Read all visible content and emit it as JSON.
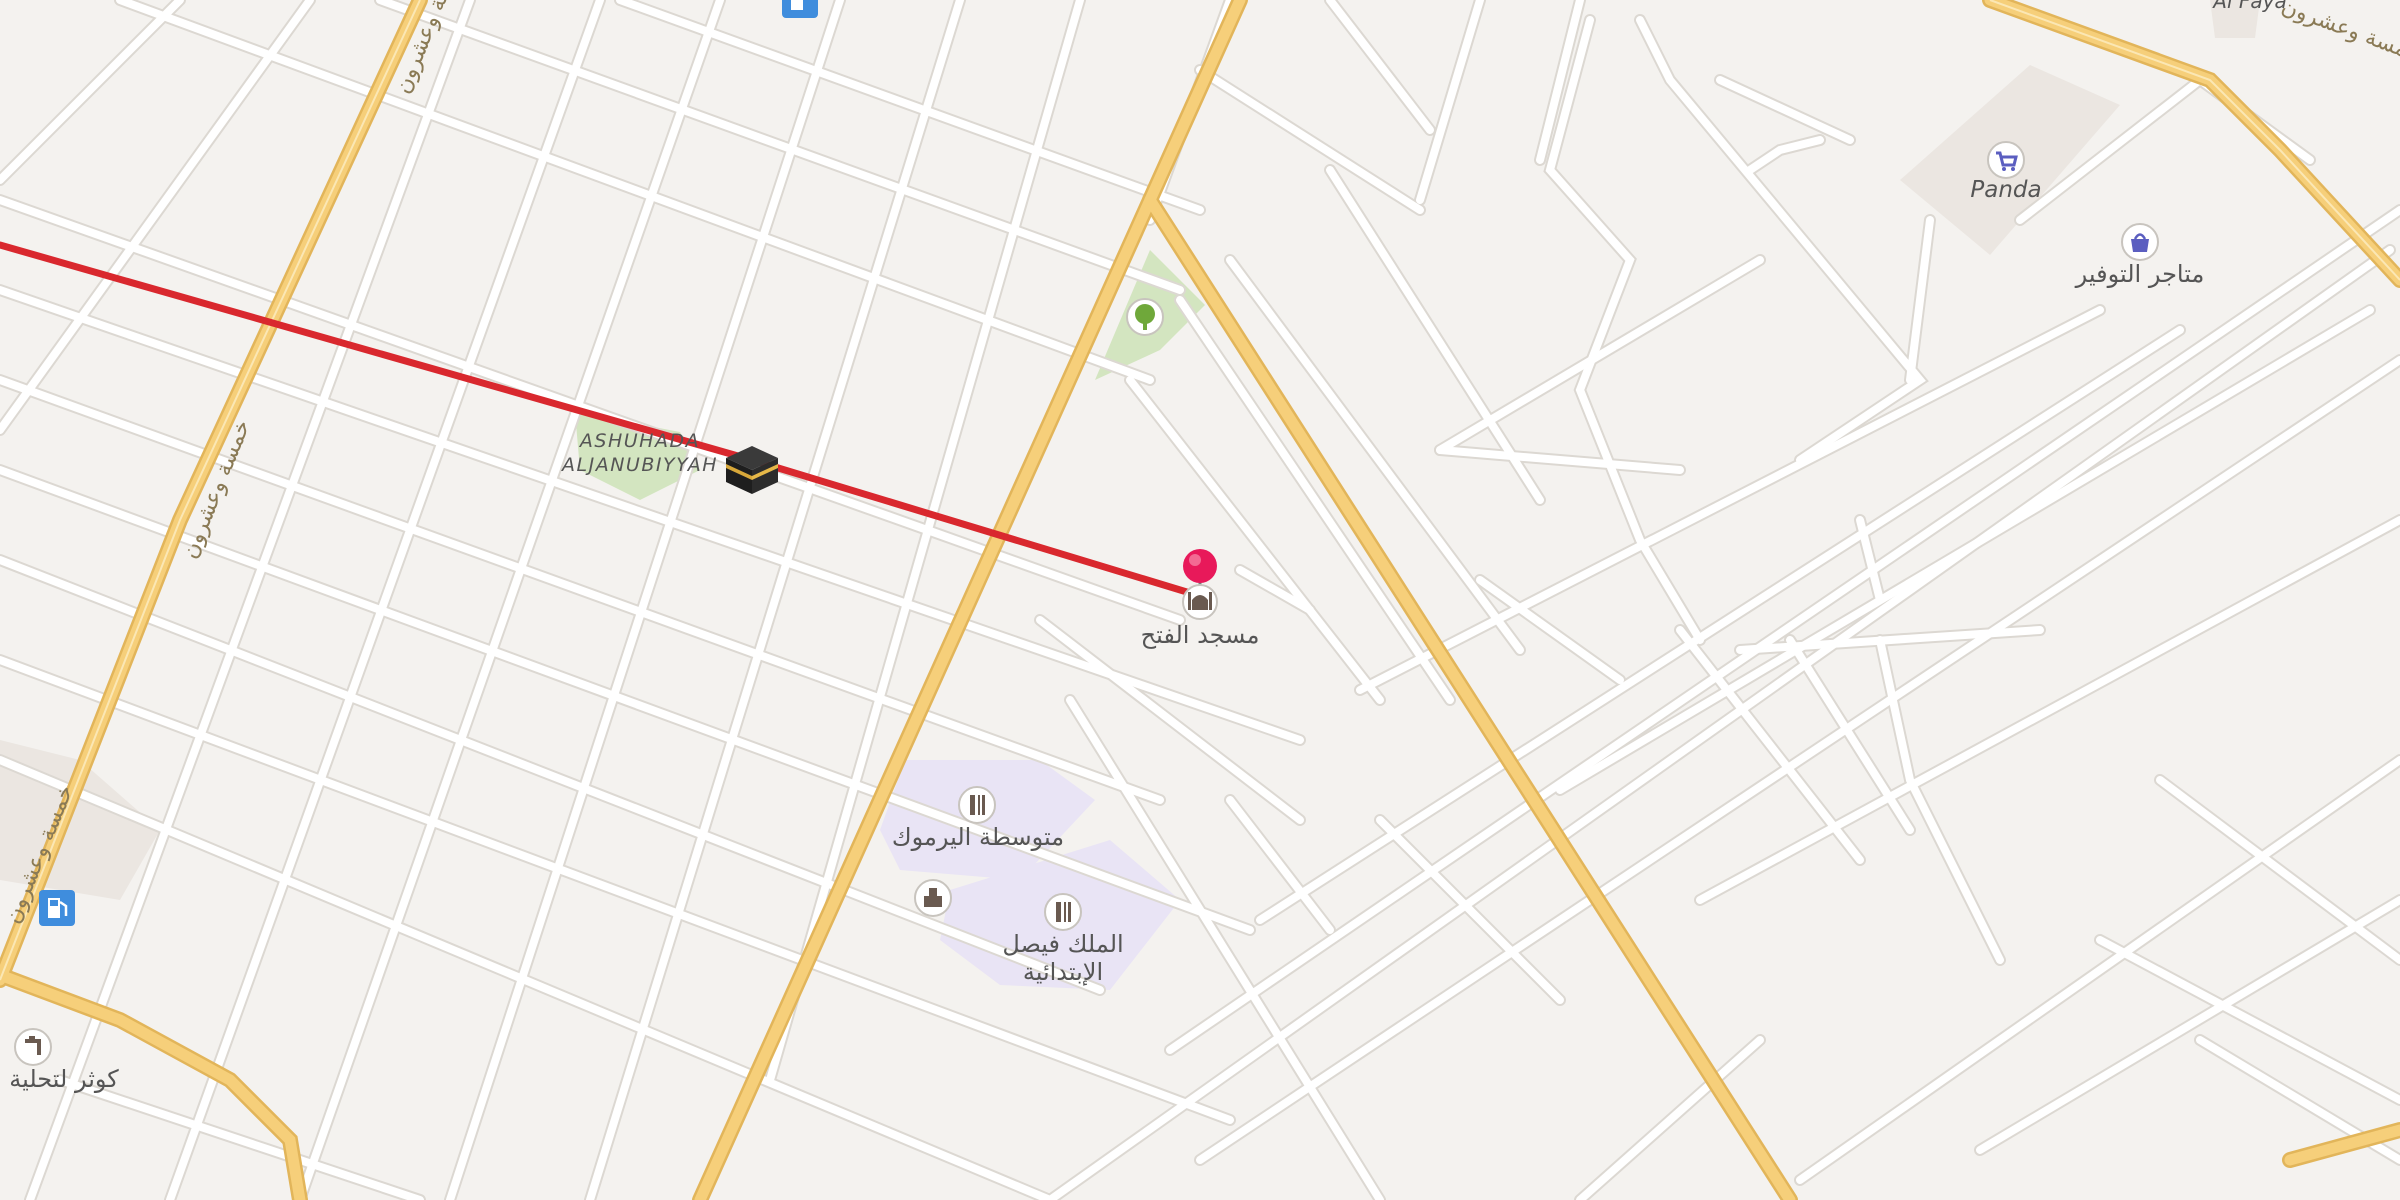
{
  "map": {
    "labels": {
      "park": "ASHUHADA ALJANUBIYYAH",
      "park_line1": "ASHUHADA",
      "park_line2": "ALJANUBIYYAH",
      "mosque": "مسجد الفتح",
      "school_1": "متوسطة اليرموك",
      "school_2_line1": "الملك فيصل",
      "school_2_line2": "الإبتدائية",
      "store": "Panda",
      "shop": "متاجر التوفير",
      "bottom_left": "كوثر لتحلية",
      "top_right": "Al Faya"
    },
    "road_labels": [
      "خمسة وعشرون",
      "خمسة وعشرون",
      "خمسة وعشرون",
      "خمسة وعشرون"
    ],
    "icons": {
      "kaaba": "kaaba-icon",
      "pin": "location-pin-icon",
      "mosque": "mosque-icon",
      "park": "tree-icon",
      "school": "school-icon",
      "store": "shopping-cart-icon",
      "shop": "shopping-bag-icon",
      "fuel": "fuel-station-icon",
      "water": "water-tap-icon",
      "government": "building-icon"
    },
    "colors": {
      "background": "#f4f2ef",
      "road": "#ffffff",
      "road_edge": "#dcd8d2",
      "major_road": "#f6cf7a",
      "major_road_edge": "#e2b55a",
      "route_line": "#d9282e",
      "park": "#d3e5c0",
      "school_area": "#e9e4f5",
      "pin": "#e8195a",
      "fuel": "#3f8ddd",
      "shop_icon": "#5b5ec0"
    }
  }
}
